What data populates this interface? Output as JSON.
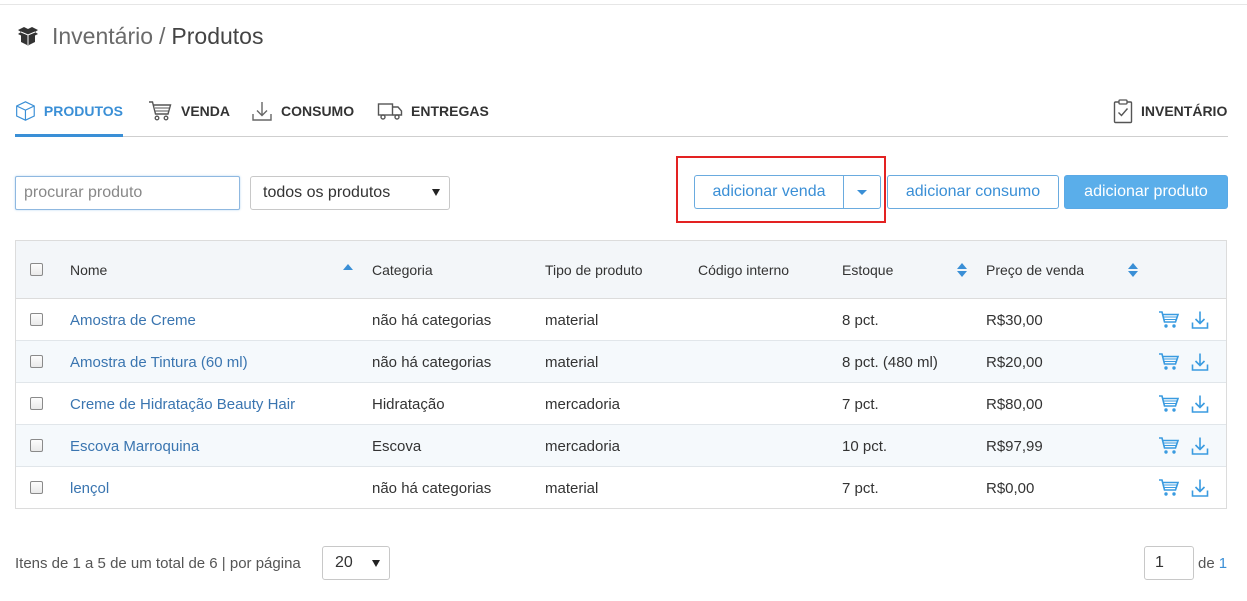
{
  "header": {
    "section": "Inventário",
    "separator": "/",
    "page_title": "Produtos"
  },
  "tabs": [
    {
      "label": "PRODUTOS",
      "icon": "box-icon",
      "active": true
    },
    {
      "label": "VENDA",
      "icon": "cart-icon",
      "active": false
    },
    {
      "label": "CONSUMO",
      "icon": "download-icon",
      "active": false
    },
    {
      "label": "ENTREGAS",
      "icon": "truck-icon",
      "active": false
    },
    {
      "label": "INVENTÁRIO",
      "icon": "clipboard-check-icon",
      "active": false
    }
  ],
  "toolbar": {
    "search_placeholder": "procurar produto",
    "filter_selected": "todos os produtos",
    "add_sale_label": "adicionar venda",
    "add_consumption_label": "adicionar consumo",
    "add_product_label": "adicionar produto"
  },
  "table": {
    "columns": [
      "Nome",
      "Categoria",
      "Tipo de produto",
      "Código interno",
      "Estoque",
      "Preço de venda"
    ],
    "rows": [
      {
        "name": "Amostra de Creme",
        "category": "não há categorias",
        "type": "material",
        "code": "",
        "stock": "8 pct.",
        "price": "R$30,00"
      },
      {
        "name": "Amostra de Tintura (60 ml)",
        "category": "não há categorias",
        "type": "material",
        "code": "",
        "stock": "8 pct. (480 ml)",
        "price": "R$20,00"
      },
      {
        "name": "Creme de Hidratação Beauty Hair",
        "category": "Hidratação",
        "type": "mercadoria",
        "code": "",
        "stock": "7 pct.",
        "price": "R$80,00"
      },
      {
        "name": "Escova Marroquina",
        "category": "Escova",
        "type": "mercadoria",
        "code": "",
        "stock": "10 pct.",
        "price": "R$97,99"
      },
      {
        "name": "lençol",
        "category": "não há categorias",
        "type": "material",
        "code": "",
        "stock": "7 pct.",
        "price": "R$0,00"
      }
    ]
  },
  "footer": {
    "summary": "Itens de 1 a 5 de um total de 6 | por página",
    "per_page": "20",
    "current_page": "1",
    "of_label": "de",
    "total_pages": "1"
  },
  "colors": {
    "accent": "#3a8fd6",
    "primary_button": "#5aaeea",
    "highlight_box": "#e32222",
    "row_alt": "#f5f9fc"
  }
}
